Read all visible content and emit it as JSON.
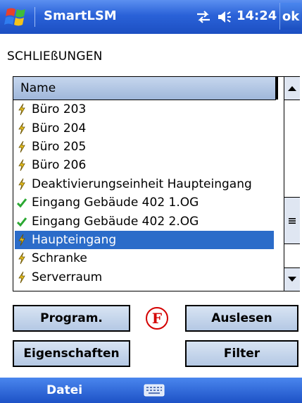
{
  "titlebar": {
    "app_title": "SmartLSM",
    "clock": "14:24",
    "ok_label": "ok",
    "icons": [
      "windows-start-icon",
      "connectivity-icon",
      "volume-icon"
    ]
  },
  "heading": "SCHLIEßUNGEN",
  "list": {
    "column_header": "Name",
    "selected_index": 7,
    "rows": [
      {
        "label": "Büro 203",
        "icon": "lock-unprogrammed-icon"
      },
      {
        "label": "Büro 204",
        "icon": "lock-unprogrammed-icon"
      },
      {
        "label": "Büro 205",
        "icon": "lock-unprogrammed-icon"
      },
      {
        "label": "Büro 206",
        "icon": "lock-unprogrammed-icon"
      },
      {
        "label": "Deaktivierungseinheit Haupteingang",
        "icon": "lock-unprogrammed-icon"
      },
      {
        "label": "Eingang Gebäude 402 1.OG",
        "icon": "checkmark-icon"
      },
      {
        "label": "Eingang Gebäude 402 2.OG",
        "icon": "checkmark-icon"
      },
      {
        "label": "Haupteingang",
        "icon": "lock-unprogrammed-icon"
      },
      {
        "label": "Schranke",
        "icon": "lock-unprogrammed-icon"
      },
      {
        "label": "Serverraum",
        "icon": "lock-unprogrammed-icon"
      }
    ]
  },
  "buttons": {
    "program": "Program.",
    "read": "Auslesen",
    "properties": "Eigenschaften",
    "filter": "Filter"
  },
  "fault_indicator": "F",
  "menubar": {
    "datei": "Datei"
  },
  "colors": {
    "titlebar": "#2a62d8",
    "selection": "#2b6cc9",
    "button_face": "#c6d7ee",
    "fault": "#d40000",
    "check": "#2aa832",
    "bolt": "#e8c020"
  }
}
